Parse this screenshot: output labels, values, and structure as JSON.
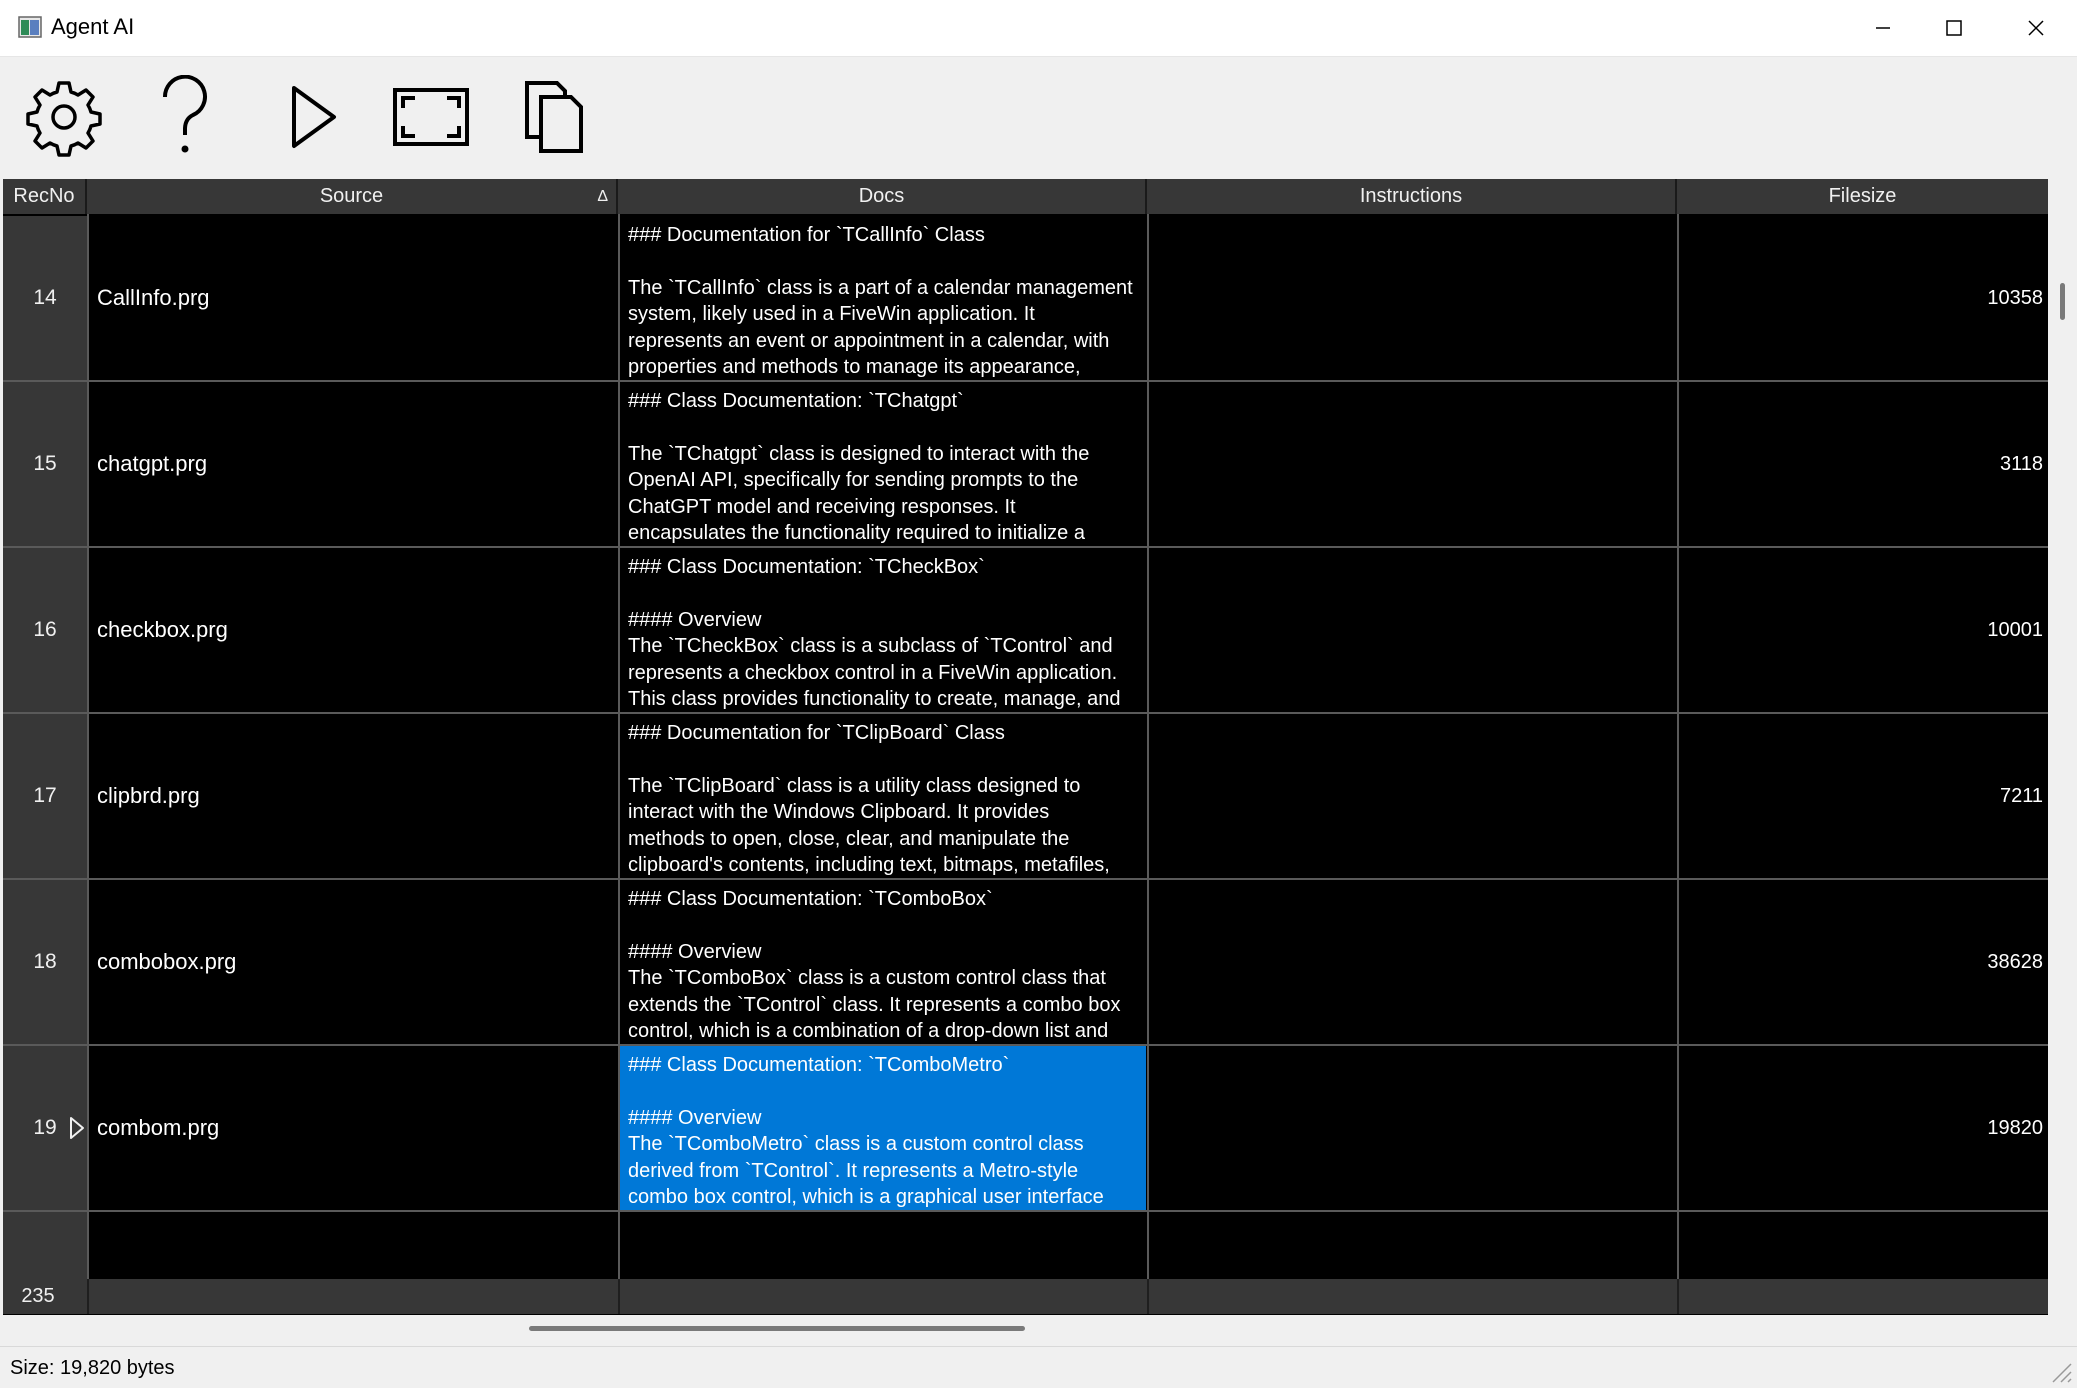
{
  "window": {
    "title": "Agent AI"
  },
  "toolbar": {
    "buttons": [
      "gear-icon",
      "help-icon",
      "play-icon",
      "fullscreen-icon",
      "copy-icon"
    ]
  },
  "grid": {
    "columns": [
      "RecNo",
      "Source",
      "Docs",
      "Instructions",
      "Filesize"
    ],
    "sort_indicator": "Δ",
    "rows": [
      {
        "recno": "14",
        "source": "CallInfo.prg",
        "docs": "### Documentation for `TCallInfo` Class\n\nThe `TCallInfo` class is a part of a calendar management\nsystem, likely used in a FiveWin application. It\nrepresents an event or appointment in a calendar, with\nproperties and methods to manage its appearance,",
        "instructions": "",
        "filesize": "10358"
      },
      {
        "recno": "15",
        "source": "chatgpt.prg",
        "docs": "### Class Documentation: `TChatgpt`\n\nThe `TChatgpt` class is designed to interact with the\nOpenAI API, specifically for sending prompts to the\nChatGPT model and receiving responses. It\nencapsulates the functionality required to initialize a",
        "instructions": "",
        "filesize": "3118"
      },
      {
        "recno": "16",
        "source": "checkbox.prg",
        "docs": "### Class Documentation: `TCheckBox`\n\n#### Overview\nThe `TCheckBox` class is a subclass of `TControl` and\nrepresents a checkbox control in a FiveWin application.\nThis class provides functionality to create, manage, and",
        "instructions": "",
        "filesize": "10001"
      },
      {
        "recno": "17",
        "source": "clipbrd.prg",
        "docs": "### Documentation for `TClipBoard` Class\n\nThe `TClipBoard` class is a utility class designed to\ninteract with the Windows Clipboard. It provides\nmethods to open, close, clear, and manipulate the\nclipboard's contents, including text, bitmaps, metafiles,",
        "instructions": "",
        "filesize": "7211"
      },
      {
        "recno": "18",
        "source": "combobox.prg",
        "docs": "### Class Documentation: `TComboBox`\n\n#### Overview\nThe `TComboBox` class is a custom control class that\nextends the `TControl` class. It represents a combo box\ncontrol, which is a combination of a drop-down list and",
        "instructions": "",
        "filesize": "38628"
      },
      {
        "recno": "19",
        "source": "combom.prg",
        "docs": "### Class Documentation: `TComboMetro`\n\n#### Overview\nThe `TComboMetro` class is a custom control class\nderived from `TControl`. It represents a Metro-style\ncombo box control, which is a graphical user interface",
        "instructions": "",
        "filesize": "19820"
      }
    ],
    "footer_count": "235"
  },
  "status": {
    "text": "Size:  19,820 bytes"
  },
  "colors": {
    "grid_bg": "#000000",
    "header_bg": "#373737",
    "selection": "#0078d7"
  }
}
